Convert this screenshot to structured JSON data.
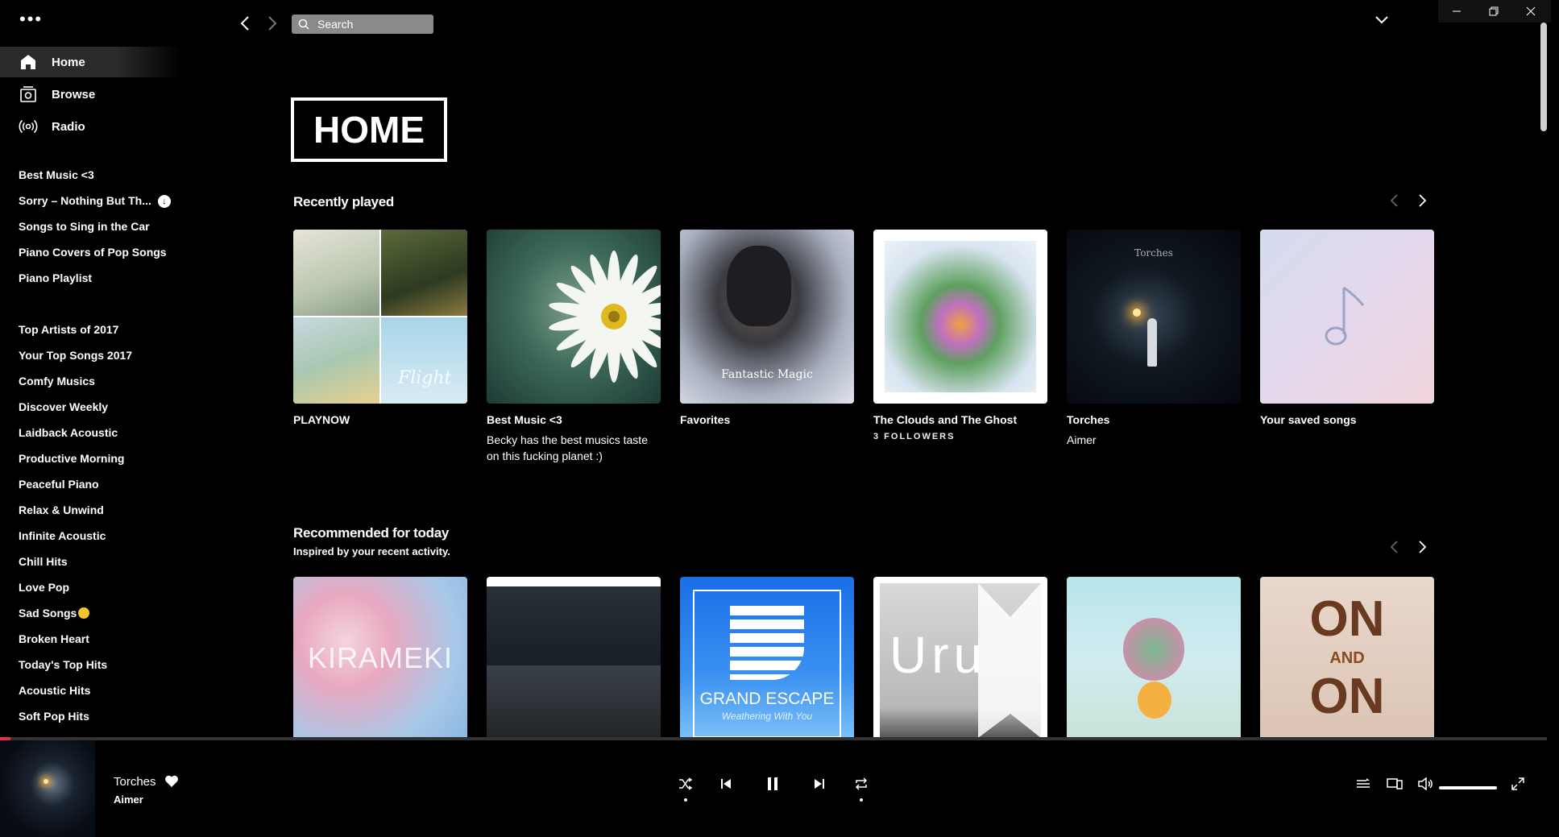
{
  "sidebar": {
    "nav": [
      {
        "label": "Home",
        "icon": "home-icon"
      },
      {
        "label": "Browse",
        "icon": "browse-icon"
      },
      {
        "label": "Radio",
        "icon": "radio-icon"
      }
    ],
    "playlists_group1": [
      "Best Music <3",
      "Sorry – Nothing But Th...",
      "Songs to Sing in the Car",
      "Piano Covers of Pop Songs",
      "Piano Playlist"
    ],
    "playlists_group2": [
      "Top Artists of 2017",
      "Your Top Songs 2017",
      "Comfy Musics",
      "Discover Weekly",
      "Laidback Acoustic",
      "Productive Morning",
      "Peaceful Piano",
      "Relax & Unwind",
      "Infinite Acoustic",
      "Chill Hits",
      "Love Pop",
      "Sad Songs",
      "Broken Heart",
      "Today's Top Hits",
      "Acoustic Hits",
      "Soft Pop Hits"
    ]
  },
  "topbar": {
    "search_placeholder": "Search"
  },
  "main": {
    "page_title": "HOME",
    "recently_played": {
      "title": "Recently played",
      "cards": [
        {
          "name": "PLAYNOW",
          "desc": "",
          "follow": "",
          "art_text": "Flight"
        },
        {
          "name": "Best Music <3",
          "desc": "Becky has the best musics taste on this fucking planet :)",
          "follow": "",
          "art_text": ""
        },
        {
          "name": "Favorites",
          "desc": "",
          "follow": "",
          "art_text": "Fantastic Magic"
        },
        {
          "name": "The Clouds and The Ghost",
          "desc": "",
          "follow": "3 FOLLOWERS",
          "art_text": ""
        },
        {
          "name": "Torches",
          "desc": "Aimer",
          "follow": "",
          "art_text": "Torches"
        },
        {
          "name": "Your saved songs",
          "desc": "",
          "follow": "",
          "art_text": ""
        }
      ]
    },
    "recommended": {
      "title": "Recommended for today",
      "subtitle": "Inspired by your recent activity.",
      "cards": [
        {
          "art_text": "KIRAMEKI"
        },
        {
          "art_text": ""
        },
        {
          "art_text": "GRAND ESCAPE",
          "art_sub": "Weathering With You"
        },
        {
          "art_text": "Uru"
        },
        {
          "art_text": ""
        },
        {
          "art_text": "ON",
          "art_mid": "AND",
          "art_end": "ON"
        }
      ]
    }
  },
  "player": {
    "track": "Torches",
    "artist": "Aimer",
    "progress": 0.007,
    "volume": 1.0
  },
  "colors": {
    "background": "#000000",
    "progress": "#e0304e",
    "search_bg": "#8a8a8a"
  }
}
